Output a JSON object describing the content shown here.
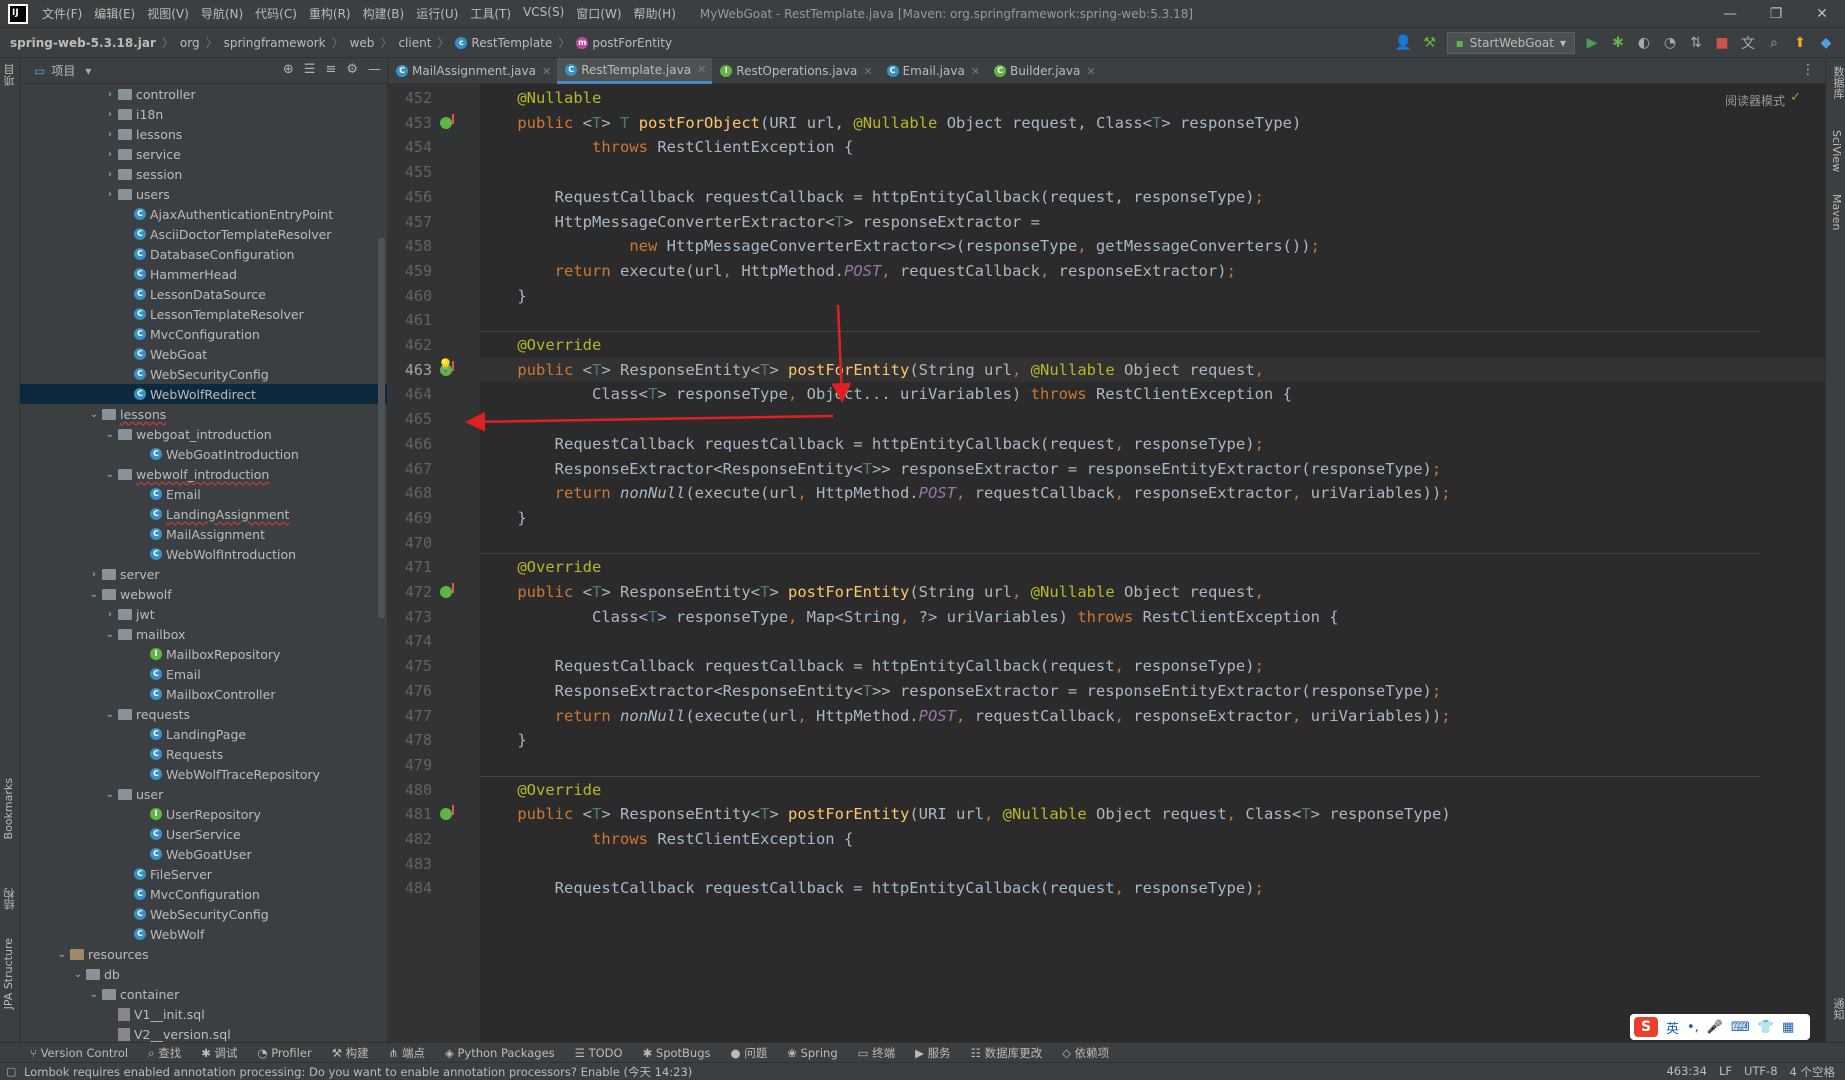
{
  "titlebar": {
    "menu": [
      "文件(F)",
      "编辑(E)",
      "视图(V)",
      "导航(N)",
      "代码(C)",
      "重构(R)",
      "构建(B)",
      "运行(U)",
      "工具(T)",
      "VCS(S)",
      "窗口(W)",
      "帮助(H)"
    ],
    "window_title": "MyWebGoat - RestTemplate.java [Maven: org.springframework:spring-web:5.3.18]"
  },
  "breadcrumb": [
    "spring-web-5.3.18.jar",
    "org",
    "springframework",
    "web",
    "client",
    "RestTemplate",
    "postForEntity"
  ],
  "run_config": "StartWebGoat",
  "project_panel": {
    "title": "项目",
    "tree": [
      {
        "label": "controller",
        "type": "folder",
        "depth": 2,
        "arrow": "›"
      },
      {
        "label": "i18n",
        "type": "folder",
        "depth": 2,
        "arrow": "›"
      },
      {
        "label": "lessons",
        "type": "folder",
        "depth": 2,
        "arrow": "›"
      },
      {
        "label": "service",
        "type": "folder",
        "depth": 2,
        "arrow": "›"
      },
      {
        "label": "session",
        "type": "folder",
        "depth": 2,
        "arrow": "›"
      },
      {
        "label": "users",
        "type": "folder",
        "depth": 2,
        "arrow": "›"
      },
      {
        "label": "AjaxAuthenticationEntryPoint",
        "type": "class",
        "depth": 3
      },
      {
        "label": "AsciiDoctorTemplateResolver",
        "type": "class",
        "depth": 3
      },
      {
        "label": "DatabaseConfiguration",
        "type": "class",
        "depth": 3
      },
      {
        "label": "HammerHead",
        "type": "class",
        "depth": 3
      },
      {
        "label": "LessonDataSource",
        "type": "class",
        "depth": 3
      },
      {
        "label": "LessonTemplateResolver",
        "type": "class",
        "depth": 3
      },
      {
        "label": "MvcConfiguration",
        "type": "class",
        "depth": 3
      },
      {
        "label": "WebGoat",
        "type": "class",
        "depth": 3
      },
      {
        "label": "WebSecurityConfig",
        "type": "class",
        "depth": 3
      },
      {
        "label": "WebWolfRedirect",
        "type": "class",
        "depth": 3,
        "selected": true
      },
      {
        "label": "lessons",
        "type": "folder",
        "depth": 1,
        "arrow": "⌄",
        "err": true
      },
      {
        "label": "webgoat_introduction",
        "type": "folder",
        "depth": 2,
        "arrow": "⌄"
      },
      {
        "label": "WebGoatIntroduction",
        "type": "class",
        "depth": 4
      },
      {
        "label": "webwolf_introduction",
        "type": "folder",
        "depth": 2,
        "arrow": "⌄",
        "err": true
      },
      {
        "label": "Email",
        "type": "class",
        "depth": 4
      },
      {
        "label": "LandingAssignment",
        "type": "class",
        "depth": 4,
        "err": true
      },
      {
        "label": "MailAssignment",
        "type": "class",
        "depth": 4
      },
      {
        "label": "WebWolfIntroduction",
        "type": "class",
        "depth": 4
      },
      {
        "label": "server",
        "type": "folder",
        "depth": 1,
        "arrow": "›"
      },
      {
        "label": "webwolf",
        "type": "folder",
        "depth": 1,
        "arrow": "⌄"
      },
      {
        "label": "jwt",
        "type": "folder",
        "depth": 2,
        "arrow": "›"
      },
      {
        "label": "mailbox",
        "type": "folder",
        "depth": 2,
        "arrow": "⌄"
      },
      {
        "label": "MailboxRepository",
        "type": "interface",
        "depth": 4
      },
      {
        "label": "Email",
        "type": "class",
        "depth": 4
      },
      {
        "label": "MailboxController",
        "type": "class",
        "depth": 4
      },
      {
        "label": "requests",
        "type": "folder",
        "depth": 2,
        "arrow": "⌄"
      },
      {
        "label": "LandingPage",
        "type": "class",
        "depth": 4
      },
      {
        "label": "Requests",
        "type": "class",
        "depth": 4
      },
      {
        "label": "WebWolfTraceRepository",
        "type": "class",
        "depth": 4
      },
      {
        "label": "user",
        "type": "folder",
        "depth": 2,
        "arrow": "⌄"
      },
      {
        "label": "UserRepository",
        "type": "interface",
        "depth": 4
      },
      {
        "label": "UserService",
        "type": "class",
        "depth": 4
      },
      {
        "label": "WebGoatUser",
        "type": "class",
        "depth": 4
      },
      {
        "label": "FileServer",
        "type": "class",
        "depth": 3
      },
      {
        "label": "MvcConfiguration",
        "type": "class",
        "depth": 3
      },
      {
        "label": "WebSecurityConfig",
        "type": "class",
        "depth": 3
      },
      {
        "label": "WebWolf",
        "type": "class",
        "depth": 3
      },
      {
        "label": "resources",
        "type": "resfolder",
        "depth": -1,
        "arrow": "⌄"
      },
      {
        "label": "db",
        "type": "folder",
        "depth": 0,
        "arrow": "⌄"
      },
      {
        "label": "container",
        "type": "folder",
        "depth": 1,
        "arrow": "⌄"
      },
      {
        "label": "V1__init.sql",
        "type": "sql",
        "depth": 2
      },
      {
        "label": "V2__version.sql",
        "type": "sql",
        "depth": 2
      }
    ]
  },
  "tabs": [
    {
      "label": "MailAssignment.java",
      "icon": "class",
      "active": false
    },
    {
      "label": "RestTemplate.java",
      "icon": "class",
      "active": true
    },
    {
      "label": "RestOperations.java",
      "icon": "interface",
      "active": false
    },
    {
      "label": "Email.java",
      "icon": "class",
      "active": false
    },
    {
      "label": "Builder.java",
      "icon": "class-g",
      "active": false
    }
  ],
  "reader_mode": "阅读器模式",
  "code_lines": [
    {
      "n": "452",
      "html": "    <span class='an'>@Nullable</span>"
    },
    {
      "n": "453",
      "ovr": true,
      "html": "    <span class='kw'>public</span> &lt;<span class='tp'>T</span>&gt; <span class='tp'>T</span> <span class='fn'>postForObject</span>(URI url, <span class='an'>@Nullable</span> Object request, Class&lt;<span class='tp'>T</span>&gt; responseType)"
    },
    {
      "n": "454",
      "html": "            <span class='kw'>throws</span> RestClientException {"
    },
    {
      "n": "455",
      "html": ""
    },
    {
      "n": "456",
      "html": "        RequestCallback requestCallback = httpEntityCallback(request, responseType)<span class='kw'>;</span>"
    },
    {
      "n": "457",
      "html": "        HttpMessageConverterExtractor&lt;<span class='tp'>T</span>&gt; responseExtractor ="
    },
    {
      "n": "458",
      "html": "                <span class='kw'>new</span> HttpMessageConverterExtractor&lt;&gt;(responseType<span class='kw'>,</span> getMessageConverters())<span class='kw'>;</span>"
    },
    {
      "n": "459",
      "html": "        <span class='kw'>return</span> execute(url<span class='kw'>,</span> HttpMethod.<span class='it'>POST</span><span class='kw'>,</span> requestCallback<span class='kw'>,</span> responseExtractor)<span class='kw'>;</span>"
    },
    {
      "n": "460",
      "html": "    }"
    },
    {
      "n": "461",
      "html": ""
    },
    {
      "n": "462",
      "html": "    <span class='an'>@Override</span>"
    },
    {
      "n": "463",
      "ovr": true,
      "cur": true,
      "html": "    <span class='kw'>public</span> &lt;<span class='tp'>T</span>&gt; ResponseEntity&lt;<span class='tp'>T</span>&gt; <span class='fn'>postForEntity</span>(String url<span class='kw'>,</span> <span class='an'>@Nullable</span> Object request<span class='kw'>,</span>"
    },
    {
      "n": "464",
      "html": "            Class&lt;<span class='tp'>T</span>&gt; responseType<span class='kw'>,</span> Object... uriVariables) <span class='kw'>throws</span> RestClientException {"
    },
    {
      "n": "465",
      "html": ""
    },
    {
      "n": "466",
      "html": "        RequestCallback requestCallback = httpEntityCallback(request<span class='kw'>,</span> responseType)<span class='kw'>;</span>"
    },
    {
      "n": "467",
      "html": "        ResponseExtractor&lt;ResponseEntity&lt;<span class='tp'>T</span>&gt;&gt; responseExtractor = responseEntityExtractor(responseType)<span class='kw'>;</span>"
    },
    {
      "n": "468",
      "html": "        <span class='kw'>return</span> <span class='sf'>nonNull</span>(execute(url<span class='kw'>,</span> HttpMethod.<span class='it'>POST</span><span class='kw'>,</span> requestCallback<span class='kw'>,</span> responseExtractor<span class='kw'>,</span> uriVariables))<span class='kw'>;</span>"
    },
    {
      "n": "469",
      "html": "    }"
    },
    {
      "n": "470",
      "html": ""
    },
    {
      "n": "471",
      "html": "    <span class='an'>@Override</span>"
    },
    {
      "n": "472",
      "ovr": true,
      "html": "    <span class='kw'>public</span> &lt;<span class='tp'>T</span>&gt; ResponseEntity&lt;<span class='tp'>T</span>&gt; <span class='fn'>postForEntity</span>(String url<span class='kw'>,</span> <span class='an'>@Nullable</span> Object request<span class='kw'>,</span>"
    },
    {
      "n": "473",
      "html": "            Class&lt;<span class='tp'>T</span>&gt; responseType<span class='kw'>,</span> Map&lt;String<span class='kw'>,</span> ?&gt; uriVariables) <span class='kw'>throws</span> RestClientException {"
    },
    {
      "n": "474",
      "html": ""
    },
    {
      "n": "475",
      "html": "        RequestCallback requestCallback = httpEntityCallback(request<span class='kw'>,</span> responseType)<span class='kw'>;</span>"
    },
    {
      "n": "476",
      "html": "        ResponseExtractor&lt;ResponseEntity&lt;<span class='tp'>T</span>&gt;&gt; responseExtractor = responseEntityExtractor(responseType)<span class='kw'>;</span>"
    },
    {
      "n": "477",
      "html": "        <span class='kw'>return</span> <span class='sf'>nonNull</span>(execute(url<span class='kw'>,</span> HttpMethod.<span class='it'>POST</span><span class='kw'>,</span> requestCallback<span class='kw'>,</span> responseExtractor<span class='kw'>,</span> uriVariables))<span class='kw'>;</span>"
    },
    {
      "n": "478",
      "html": "    }"
    },
    {
      "n": "479",
      "html": ""
    },
    {
      "n": "480",
      "html": "    <span class='an'>@Override</span>"
    },
    {
      "n": "481",
      "ovr": true,
      "html": "    <span class='kw'>public</span> &lt;<span class='tp'>T</span>&gt; ResponseEntity&lt;<span class='tp'>T</span>&gt; <span class='fn'>postForEntity</span>(URI url<span class='kw'>,</span> <span class='an'>@Nullable</span> Object request<span class='kw'>,</span> Class&lt;<span class='tp'>T</span>&gt; responseType)"
    },
    {
      "n": "482",
      "html": "            <span class='kw'>throws</span> RestClientException {"
    },
    {
      "n": "483",
      "html": ""
    },
    {
      "n": "484",
      "html": "        RequestCallback requestCallback = httpEntityCallback(request<span class='kw'>,</span> responseType)<span class='kw'>;</span>"
    }
  ],
  "bottom_tools": [
    "Version Control",
    "查找",
    "调试",
    "Profiler",
    "构建",
    "端点",
    "Python Packages",
    "TODO",
    "SpotBugs",
    "问题",
    "Spring",
    "终端",
    "服务",
    "数据库更改",
    "依赖项"
  ],
  "status": {
    "message": "Lombok requires enabled annotation processing: Do you want to enable annotation processors? Enable (今天 14:23)",
    "position": "463:34",
    "line_sep": "LF",
    "encoding": "UTF-8",
    "indent": "4 个空格"
  },
  "left_strip_labels": [
    "项目",
    "Bookmarks",
    "结构",
    "JPA Structure"
  ],
  "right_strip_labels": [
    "数据库",
    "SciView",
    "Maven",
    "通知"
  ],
  "ime": {
    "logo": "S",
    "lang": "英"
  }
}
